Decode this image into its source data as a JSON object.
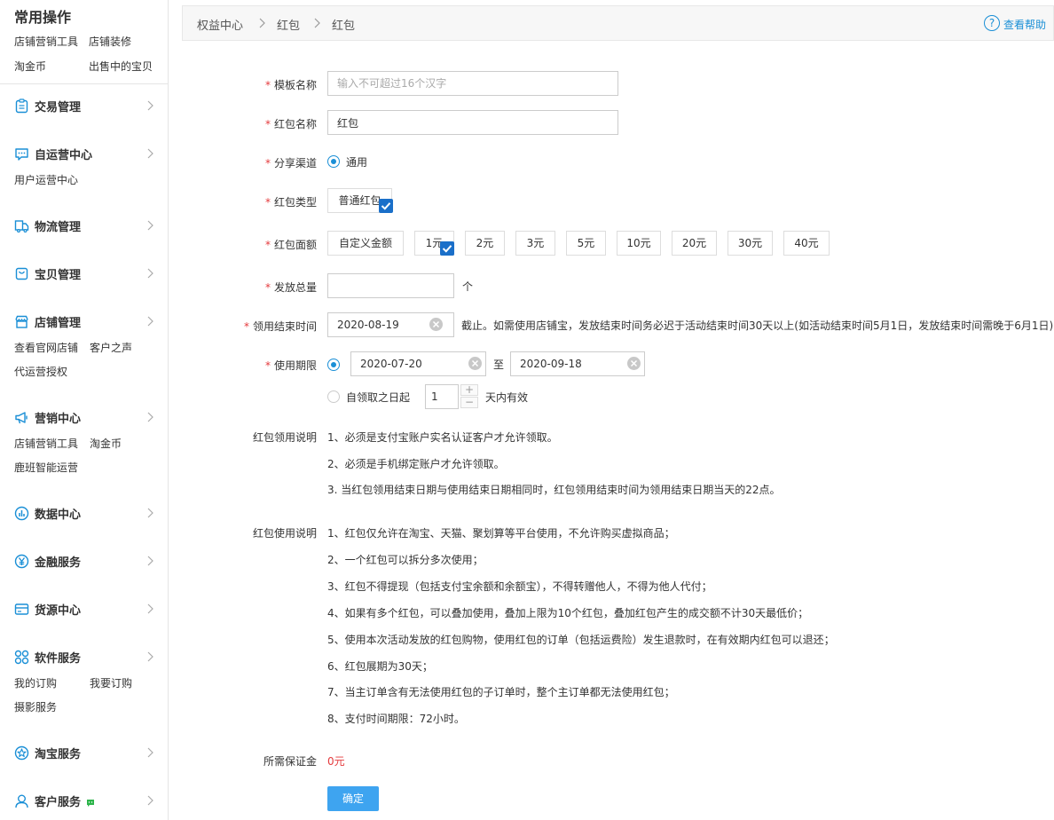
{
  "sidebar": {
    "common_title": "常用操作",
    "common_links": [
      "店铺营销工具",
      "店铺装修",
      "淘金币",
      "出售中的宝贝"
    ],
    "groups": [
      {
        "label": "交易管理",
        "icon": "clipboard-icon",
        "sub": []
      },
      {
        "label": "自运营中心",
        "icon": "chat-icon",
        "sub": [
          "用户运营中心"
        ]
      },
      {
        "label": "物流管理",
        "icon": "logistics-icon",
        "sub": []
      },
      {
        "label": "宝贝管理",
        "icon": "bag-icon",
        "sub": []
      },
      {
        "label": "店铺管理",
        "icon": "store-icon",
        "sub": [
          "查看官网店铺",
          "客户之声",
          "代运营授权"
        ]
      },
      {
        "label": "营销中心",
        "icon": "megaphone-icon",
        "sub": [
          "店铺营销工具",
          "淘金币",
          "鹿班智能运营"
        ]
      },
      {
        "label": "数据中心",
        "icon": "chart-icon",
        "sub": []
      },
      {
        "label": "金融服务",
        "icon": "yen-icon",
        "sub": []
      },
      {
        "label": "货源中心",
        "icon": "card-icon",
        "sub": []
      },
      {
        "label": "软件服务",
        "icon": "apps-icon",
        "sub": [
          "我的订购",
          "我要订购",
          "摄影服务"
        ]
      },
      {
        "label": "淘宝服务",
        "icon": "star-icon",
        "sub": []
      },
      {
        "label": "客户服务",
        "icon": "user-icon",
        "sub": []
      }
    ]
  },
  "header": {
    "breadcrumb": [
      "权益中心",
      "红包",
      "红包"
    ],
    "help": "查看帮助"
  },
  "form": {
    "template_name": {
      "label": "模板名称",
      "placeholder": "输入不可超过16个汉字",
      "value": ""
    },
    "packet_name": {
      "label": "红包名称",
      "value": "红包"
    },
    "share_channel": {
      "label": "分享渠道",
      "option": "通用"
    },
    "packet_type": {
      "label": "红包类型",
      "option": "普通红包"
    },
    "denomination": {
      "label": "红包面额",
      "options": [
        "自定义金额",
        "1元",
        "2元",
        "3元",
        "5元",
        "10元",
        "20元",
        "30元",
        "40元"
      ],
      "selected": "1元"
    },
    "total": {
      "label": "发放总量",
      "value": "",
      "unit": "个"
    },
    "claim_end": {
      "label": "领用结束时间",
      "value": "2020-08-19",
      "note": "截止。如需使用店铺宝，发放结束时间务必迟于活动结束时间30天以上(如活动结束时间5月1日，发放结束时间需晚于6月1日)"
    },
    "use_period": {
      "label": "使用期限",
      "start": "2020-07-20",
      "to": "至",
      "end": "2020-09-18",
      "alt_option": "自领取之日起",
      "days": "1",
      "days_suffix": "天内有效"
    },
    "claim_rules": {
      "label": "红包领用说明",
      "items": [
        "1、必须是支付宝账户实名认证客户才允许领取。",
        "2、必须是手机绑定账户才允许领取。",
        "3. 当红包领用结束日期与使用结束日期相同时，红包领用结束时间为领用结束日期当天的22点。"
      ]
    },
    "use_rules": {
      "label": "红包使用说明",
      "items": [
        "1、红包仅允许在淘宝、天猫、聚划算等平台使用，不允许购买虚拟商品；",
        "2、一个红包可以拆分多次使用；",
        "3、红包不得提现（包括支付宝余额和余额宝），不得转赠他人，不得为他人代付；",
        "4、如果有多个红包，可以叠加使用，叠加上限为10个红包，叠加红包产生的成交额不计30天最低价；",
        "5、使用本次活动发放的红包购物，使用红包的订单（包括运费险）发生退款时，在有效期内红包可以退还；",
        "6、红包展期为30天；",
        "7、当主订单含有无法使用红包的子订单时，整个主订单都无法使用红包；",
        "8、支付时间期限：72小时。"
      ]
    },
    "deposit": {
      "label": "所需保证金",
      "value": "0元"
    },
    "submit": "确定"
  },
  "colors": {
    "accent": "#1a8fd6",
    "required": "#e4393c",
    "primary_button": "#3ea4f0"
  }
}
